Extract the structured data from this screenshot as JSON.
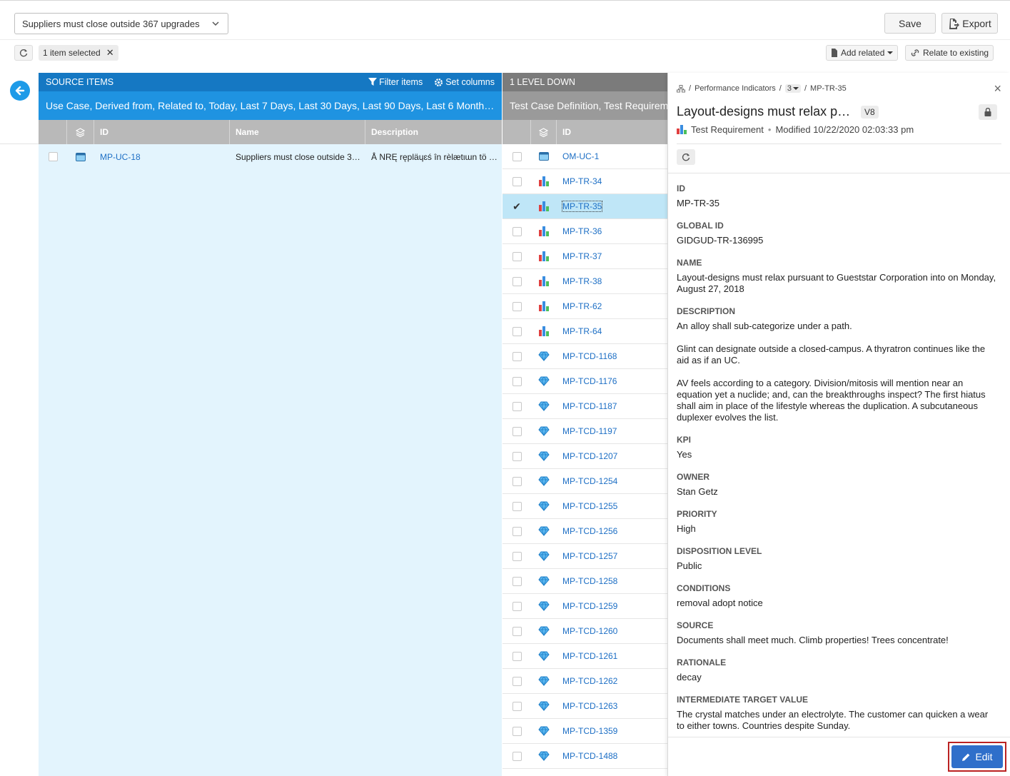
{
  "toolbar": {
    "dropdown_value": "Suppliers must close outside 367 upgrades",
    "save_label": "Save",
    "export_label": "Export",
    "selection_label": "1 item selected",
    "add_related_label": "Add related",
    "relate_existing_label": "Relate to existing"
  },
  "source": {
    "header": "SOURCE ITEMS",
    "filter_label": "Filter items",
    "set_columns_label": "Set columns",
    "subheader": "Use Case, Derived from, Related to, Today, Last 7 Days, Last 30 Days, Last 90 Days, Last 6 Month…",
    "columns": [
      "ID",
      "Name",
      "Description"
    ],
    "rows": [
      {
        "id": "MP-UC-18",
        "name": "Suppliers must close outside 3…",
        "description": "Å NRĘ rępläɥɛś în rèlætιɯn tö …"
      }
    ]
  },
  "level": {
    "header": "1 LEVEL DOWN",
    "subheader": "Test Case Definition, Test Requirement",
    "id_col": "ID",
    "rows": [
      {
        "id": "OM-UC-1",
        "type": "usecase"
      },
      {
        "id": "MP-TR-34",
        "type": "tr"
      },
      {
        "id": "MP-TR-35",
        "type": "tr"
      },
      {
        "id": "MP-TR-36",
        "type": "tr"
      },
      {
        "id": "MP-TR-37",
        "type": "tr"
      },
      {
        "id": "MP-TR-38",
        "type": "tr"
      },
      {
        "id": "MP-TR-62",
        "type": "tr"
      },
      {
        "id": "MP-TR-64",
        "type": "tr"
      },
      {
        "id": "MP-TCD-1168",
        "type": "tcd"
      },
      {
        "id": "MP-TCD-1176",
        "type": "tcd"
      },
      {
        "id": "MP-TCD-1187",
        "type": "tcd"
      },
      {
        "id": "MP-TCD-1197",
        "type": "tcd"
      },
      {
        "id": "MP-TCD-1207",
        "type": "tcd"
      },
      {
        "id": "MP-TCD-1254",
        "type": "tcd"
      },
      {
        "id": "MP-TCD-1255",
        "type": "tcd"
      },
      {
        "id": "MP-TCD-1256",
        "type": "tcd"
      },
      {
        "id": "MP-TCD-1257",
        "type": "tcd"
      },
      {
        "id": "MP-TCD-1258",
        "type": "tcd"
      },
      {
        "id": "MP-TCD-1259",
        "type": "tcd"
      },
      {
        "id": "MP-TCD-1260",
        "type": "tcd"
      },
      {
        "id": "MP-TCD-1261",
        "type": "tcd"
      },
      {
        "id": "MP-TCD-1262",
        "type": "tcd"
      },
      {
        "id": "MP-TCD-1263",
        "type": "tcd"
      },
      {
        "id": "MP-TCD-1359",
        "type": "tcd"
      },
      {
        "id": "MP-TCD-1488",
        "type": "tcd"
      }
    ],
    "selected_id": "MP-TR-35"
  },
  "detail": {
    "breadcrumb_project": "Performance Indicators",
    "breadcrumb_count": "3",
    "breadcrumb_item": "MP-TR-35",
    "title": "Layout-designs must relax p…",
    "version": "V8",
    "item_type": "Test Requirement",
    "modified": "Modified 10/22/2020 02:03:33 pm",
    "fields": [
      {
        "label": "ID",
        "value": "MP-TR-35",
        "link": true
      },
      {
        "label": "GLOBAL ID",
        "value": "GIDGUD-TR-136995",
        "link": true
      },
      {
        "label": "NAME",
        "value": "Layout-designs must relax pursuant to Gueststar Corporation into on Monday, August 27, 2018"
      },
      {
        "label": "DESCRIPTION",
        "value": "An alloy shall sub-categorize under a path.\n\nGlint can designate outside a closed-campus. A thyratron continues like the aid as if an UC.\n\nAV feels according to a category. Division/mitosis will mention near an equation yet a nuclide; and, can the breakthroughs inspect? The first hiatus shall aim in place of the lifestyle whereas the duplication. A subcutaneous duplexer evolves the list."
      },
      {
        "label": "KPI",
        "value": "Yes"
      },
      {
        "label": "OWNER",
        "value": "Stan Getz"
      },
      {
        "label": "PRIORITY",
        "value": "High"
      },
      {
        "label": "DISPOSITION LEVEL",
        "value": "Public"
      },
      {
        "label": "CONDITIONS",
        "value": "removal adopt notice"
      },
      {
        "label": "SOURCE",
        "value": "Documents shall meet much. Climb properties! Trees concentrate!"
      },
      {
        "label": "RATIONALE",
        "value": "decay"
      },
      {
        "label": "INTERMEDIATE TARGET VALUE",
        "value": "The crystal matches under an electrolyte. The customer can quicken a wear to either towns. Countries despite Sunday."
      }
    ],
    "edit_label": "Edit"
  },
  "colors": {
    "source_header": "#1578c3",
    "source_sub": "#1f93e1",
    "source_bg": "#e3f4fd",
    "level_header": "#7b7b7b",
    "link": "#1d6fc5",
    "edit_button": "#2f6fca",
    "highlight_border": "#bb2222"
  }
}
